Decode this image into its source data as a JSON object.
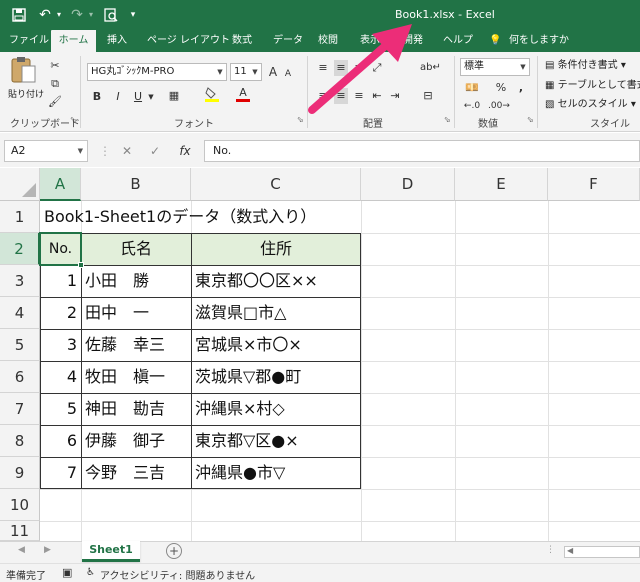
{
  "titlebar": {
    "title": "Book1.xlsx  -  Excel",
    "qat": [
      "save-icon",
      "undo-icon",
      "redo-icon",
      "print-preview-icon",
      "customize-icon"
    ]
  },
  "tabs": [
    "ファイル",
    "ホーム",
    "挿入",
    "ページ レイアウト",
    "数式",
    "データ",
    "校閲",
    "表示",
    "開発",
    "ヘルプ",
    "何をしますか"
  ],
  "ribbon": {
    "paste_label": "貼り付け",
    "clipboard_label": "クリップボード",
    "font_name": "HG丸ｺﾞｼｯｸM-PRO",
    "font_size": "11",
    "bold": "B",
    "italic": "I",
    "underline": "U",
    "font_grow": "A",
    "font_shrink": "A",
    "font_color_glyph": "A",
    "font_label": "フォント",
    "alignment_label": "配置",
    "number_format": "標準",
    "percent": "%",
    "comma": ",",
    "number_label": "数値",
    "cond_format": "条件付き書式",
    "table_format": "テーブルとして書式設定",
    "cell_styles": "セルのスタイル",
    "styles_label": "スタイル"
  },
  "formula_bar": {
    "name_box": "A2",
    "fx": "fx",
    "content": "No."
  },
  "columns": [
    "A",
    "B",
    "C",
    "D",
    "E",
    "F"
  ],
  "rows": [
    "1",
    "2",
    "3",
    "4",
    "5",
    "6",
    "7",
    "8",
    "9",
    "10",
    "11"
  ],
  "sheet": {
    "title": "Book1-Sheet1のデータ（数式入り）",
    "headers": [
      "No.",
      "氏名",
      "住所"
    ],
    "records": [
      {
        "no": "1",
        "name": "小田　勝",
        "address": "東京都〇〇区××"
      },
      {
        "no": "2",
        "name": "田中　一",
        "address": "滋賀県□市△"
      },
      {
        "no": "3",
        "name": "佐藤　幸三",
        "address": "宮城県×市〇×"
      },
      {
        "no": "4",
        "name": "牧田　槇一",
        "address": "茨城県▽郡●町"
      },
      {
        "no": "5",
        "name": "神田　勘吉",
        "address": "沖縄県×村◇"
      },
      {
        "no": "6",
        "name": "伊藤　御子",
        "address": "東京都▽区●×"
      },
      {
        "no": "7",
        "name": "今野　三吉",
        "address": "沖縄県●市▽"
      }
    ]
  },
  "sheet_tab": "Sheet1",
  "status": {
    "ready": "準備完了",
    "accessibility": "アクセシビリティ: 問題ありません"
  },
  "colors": {
    "excel_green": "#217346",
    "header_fill": "#e2efda",
    "arrow": "#ec2d78"
  }
}
